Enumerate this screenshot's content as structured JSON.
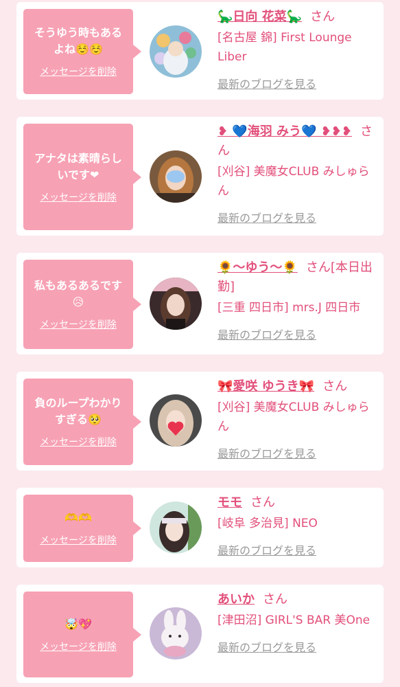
{
  "delete_label": "メッセージを削除",
  "san_suffix": "さん",
  "blog_label": "最新のブログを見る",
  "cards": [
    {
      "message": "そうゆう時もあるよね☺️☺️",
      "name": "🦕日向 花菜🦕",
      "status": "",
      "shop": "[名古屋 錦] First Lounge Liber"
    },
    {
      "message": "アナタは素晴らしいです❤︎",
      "name": "❥ 💙海羽 みう💙 ❥❥❥",
      "status": "",
      "shop": "[刈谷] 美魔女CLUB みしゅらん"
    },
    {
      "message": "私もあるあるです😥",
      "name": "🌻〜ゆう〜🌻",
      "status": "[本日出勤]",
      "shop": "[三重 四日市] mrs.J 四日市"
    },
    {
      "message": "負のループわかりすぎる🥺",
      "name": "🎀愛咲 ゆうき🎀",
      "status": "",
      "shop": "[刈谷] 美魔女CLUB みしゅらん"
    },
    {
      "message": "🫶🫶",
      "name": "モモ",
      "status": "",
      "shop": "[岐阜 多治見] NEO"
    },
    {
      "message": "🤯💖",
      "name": "あいか",
      "status": "",
      "shop": "[津田沼] GIRL'S BAR 美One"
    }
  ],
  "colors": {
    "accent": "#e24f7a",
    "bubble": "#f7a1b4",
    "background": "#fbe9ee",
    "link": "#999999"
  }
}
